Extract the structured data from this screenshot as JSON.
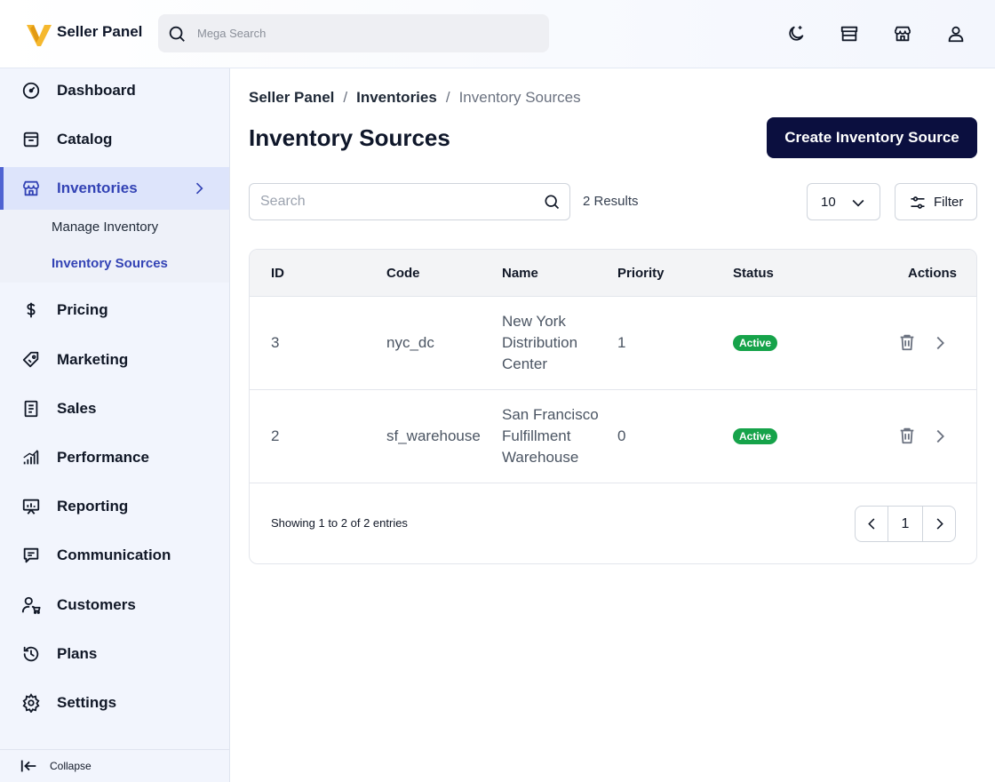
{
  "header": {
    "brand": "Seller Panel",
    "search_placeholder": "Mega Search",
    "icons": [
      "theme-toggle-icon",
      "storefront-icon",
      "store-icon",
      "user-icon"
    ]
  },
  "sidebar": {
    "items": [
      {
        "label": "Dashboard",
        "icon": "dashboard-icon"
      },
      {
        "label": "Catalog",
        "icon": "catalog-icon"
      },
      {
        "label": "Inventories",
        "icon": "warehouse-icon",
        "active": true
      },
      {
        "label": "Pricing",
        "icon": "dollar-icon"
      },
      {
        "label": "Marketing",
        "icon": "tag-icon"
      },
      {
        "label": "Sales",
        "icon": "document-icon"
      },
      {
        "label": "Performance",
        "icon": "bar-chart-icon"
      },
      {
        "label": "Reporting",
        "icon": "presentation-icon"
      },
      {
        "label": "Communication",
        "icon": "chat-icon"
      },
      {
        "label": "Customers",
        "icon": "customers-icon"
      },
      {
        "label": "Plans",
        "icon": "history-icon"
      },
      {
        "label": "Settings",
        "icon": "gear-icon"
      }
    ],
    "submenu": [
      {
        "label": "Manage Inventory"
      },
      {
        "label": "Inventory Sources",
        "active": true
      }
    ],
    "collapse_label": "Collapse"
  },
  "breadcrumb": {
    "items": [
      "Seller Panel",
      "Inventories",
      "Inventory Sources"
    ],
    "separator": "/"
  },
  "page": {
    "title": "Inventory Sources",
    "create_label": "Create Inventory Source"
  },
  "toolbar": {
    "search_placeholder": "Search",
    "results": "2 Results",
    "per_page": "10",
    "filter_label": "Filter"
  },
  "table": {
    "columns": [
      "ID",
      "Code",
      "Name",
      "Priority",
      "Status",
      "Actions"
    ],
    "rows": [
      {
        "id": "3",
        "code": "nyc_dc",
        "name": "New York Distribution Center",
        "priority": "1",
        "status": "Active"
      },
      {
        "id": "2",
        "code": "sf_warehouse",
        "name": "San Francisco Fulfillment Warehouse",
        "priority": "0",
        "status": "Active"
      }
    ],
    "showing": "Showing 1 to 2 of 2 entries",
    "current_page": "1"
  },
  "colors": {
    "accent": "#3343b5",
    "primary_button": "#0b0f3f",
    "status_active": "#16a34a",
    "logo_yellow": "#f5b82e"
  }
}
